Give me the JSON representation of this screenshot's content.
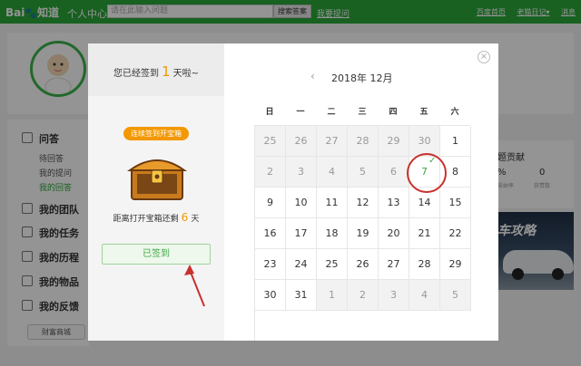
{
  "topbar": {
    "logo_text": "Bai",
    "logo_suffix": "知道",
    "user_center": "个人中心",
    "search_placeholder": "请在此输入问题",
    "search_button": "搜索答案",
    "ask_link": "我要提问",
    "right_links": [
      "百度首页",
      "老猫日记▾",
      "消息"
    ]
  },
  "sidebar": {
    "section_title": "问答",
    "sub_items": [
      "待回答",
      "我的提问",
      "我的回答"
    ],
    "items": [
      "我的团队",
      "我的任务",
      "我的历程",
      "我的物品",
      "我的反馈"
    ],
    "shop_button": "财富商城"
  },
  "right_panel": {
    "title": "题贡献",
    "stat1_value": "%",
    "stat2_value": "0",
    "stat1_label": "采纳率",
    "stat2_label": "获赞数",
    "ad_text": "车攻略"
  },
  "modal": {
    "signed_prefix": "您已经签到",
    "signed_days": "1",
    "signed_suffix": "天啦~",
    "chest_label": "连续签到开宝箱",
    "distance_prefix": "距离打开宝箱还剩",
    "distance_days": "6",
    "distance_suffix": "天",
    "signed_button": "已签到",
    "close_symbol": "×",
    "prev_symbol": "‹",
    "month_title": "2018年 12月",
    "weekdays": [
      "日",
      "一",
      "二",
      "三",
      "四",
      "五",
      "六"
    ],
    "days": [
      [
        "25",
        "26",
        "27",
        "28",
        "29",
        "30",
        "1"
      ],
      [
        "2",
        "3",
        "4",
        "5",
        "6",
        "7",
        "8"
      ],
      [
        "9",
        "10",
        "11",
        "12",
        "13",
        "14",
        "15"
      ],
      [
        "16",
        "17",
        "18",
        "19",
        "20",
        "21",
        "22"
      ],
      [
        "23",
        "24",
        "25",
        "26",
        "27",
        "28",
        "29"
      ],
      [
        "30",
        "31",
        "1",
        "2",
        "3",
        "4",
        "5"
      ]
    ],
    "muted_days": [
      [
        true,
        true,
        true,
        true,
        true,
        true,
        false
      ],
      [
        true,
        true,
        true,
        true,
        true,
        false,
        false
      ],
      [
        false,
        false,
        false,
        false,
        false,
        false,
        false
      ],
      [
        false,
        false,
        false,
        false,
        false,
        false,
        false
      ],
      [
        false,
        false,
        false,
        false,
        false,
        false,
        false
      ],
      [
        false,
        false,
        true,
        true,
        true,
        true,
        true
      ]
    ],
    "signed_day": "7",
    "check_symbol": "✓"
  },
  "colors": {
    "brand_green": "#2aa839",
    "accent_orange": "#f39800",
    "annotation_red": "#c9302c"
  }
}
